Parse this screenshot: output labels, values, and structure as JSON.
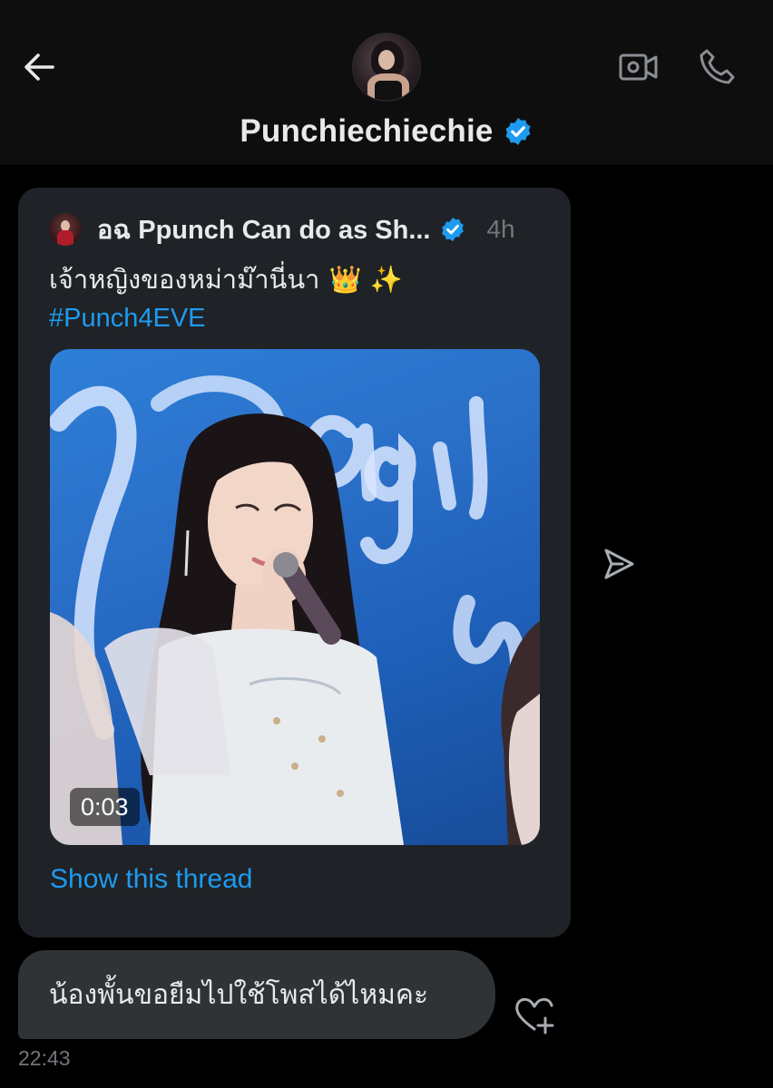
{
  "header": {
    "name": "Punchiechiechie",
    "verified": true
  },
  "shared_tweet": {
    "author_name": "อฉ Ppunch Can do as Sh...",
    "verified": true,
    "time": "4h",
    "text": "เจ้าหญิงของหม่าม๊านี่นา",
    "emojis": "👑 ✨",
    "hashtag": "#Punch4EVE",
    "media": {
      "type": "video",
      "duration": "0:03"
    },
    "show_thread_label": "Show this thread"
  },
  "message": {
    "text": "น้องพั้นขอยืมไปใช้โพสได้ไหมคะ",
    "time": "22:43"
  },
  "colors": {
    "accent": "#1d9bf0",
    "background": "#000000",
    "card": "#1f2226",
    "bubble": "#2f3336",
    "secondary_text": "#71767b"
  },
  "icons": {
    "back": "back-arrow-icon",
    "video_call": "video-camera-icon",
    "call": "phone-icon",
    "verified": "verified-badge-icon",
    "share": "share-send-icon",
    "react": "heart-add-icon"
  }
}
